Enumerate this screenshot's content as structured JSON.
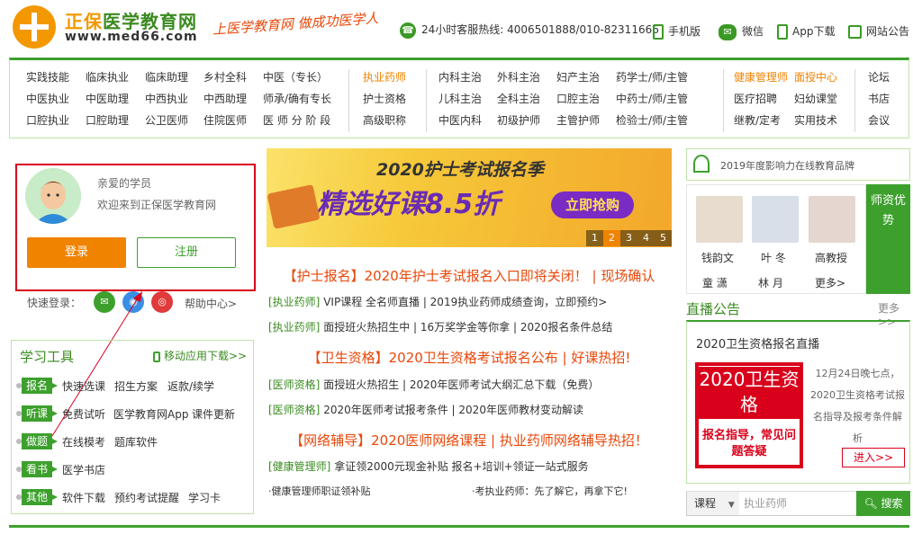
{
  "header": {
    "brand_orange": "正保",
    "brand_green": "医学教育网",
    "domain": "www.med66.com",
    "slogan": "上医学教育网 做成功医学人",
    "hotline_label": "24小时客服热线:",
    "hotline_numbers": "4006501888/010-82311666",
    "links": [
      "手机版",
      "微信",
      "App下载",
      "网站公告"
    ]
  },
  "nav": {
    "col1": [
      [
        "实践技能",
        "临床执业",
        "临床助理",
        "乡村全科",
        "中医（专长）"
      ],
      [
        "中医执业",
        "中医助理",
        "中西执业",
        "中西助理",
        "师承/确有专长"
      ],
      [
        "口腔执业",
        "口腔助理",
        "公卫医师",
        "住院医师",
        "医 师 分 阶 段"
      ]
    ],
    "col2": [
      "执业药师",
      "护士资格",
      "高级职称"
    ],
    "col3": [
      [
        "内科主治",
        "外科主治",
        "妇产主治",
        "药学士/师/主管"
      ],
      [
        "儿科主治",
        "全科主治",
        "口腔主治",
        "中药士/师/主管"
      ],
      [
        "中医内科",
        "初级护师",
        "主管护师",
        "检验士/师/主管"
      ]
    ],
    "col4": [
      [
        "健康管理师",
        "面授中心"
      ],
      [
        "医疗招聘",
        "妇幼课堂"
      ],
      [
        "继教/定考",
        "实用技术"
      ]
    ],
    "col5": [
      "论坛",
      "书店",
      "会议"
    ]
  },
  "user": {
    "greeting1": "亲爱的学员",
    "greeting2": "欢迎来到正保医学教育网",
    "login": "登录",
    "register": "注册",
    "quick_login": "快速登录：",
    "help": "帮助中心>"
  },
  "tools": {
    "title": "学习工具",
    "mobile": "移动应用下载>>",
    "rows": [
      {
        "tag": "报名",
        "links": [
          "快速选课",
          "招生方案",
          "返款/续学"
        ]
      },
      {
        "tag": "听课",
        "links": [
          "免费试听",
          "医学教育网App",
          "课件更新"
        ]
      },
      {
        "tag": "做题",
        "links": [
          "在线模考",
          "题库软件"
        ]
      },
      {
        "tag": "看书",
        "links": [
          "医学书店"
        ]
      },
      {
        "tag": "其他",
        "links": [
          "软件下载",
          "预约考试提醒",
          "学习卡"
        ]
      }
    ]
  },
  "banner": {
    "line1": "2020护士考试报名季",
    "line2": "精选好课8.5折",
    "cta": "立即抢购",
    "pages": [
      "1",
      "2",
      "3",
      "4",
      "5"
    ]
  },
  "news": {
    "h1": "【护士报名】2020年护士考试报名入口即将关闭！ | 现场确认",
    "r1": {
      "cat": "[执业药师]",
      "text": "VIP课程 全名师直播 | 2019执业药师成绩查询，立即预约>"
    },
    "r2": {
      "cat": "[执业药师]",
      "text": "面授班火热招生中 | 16万奖学金等你拿 | 2020报名条件总结"
    },
    "h2": "【卫生资格】2020卫生资格考试报名公布 | 好课热招!",
    "r3": {
      "cat": "[医师资格]",
      "text": "面授班火热招生 | 2020年医师考试大纲汇总下载（免费）"
    },
    "r4": {
      "cat": "[医师资格]",
      "text": "2020年医师考试报考条件 | 2020年医师教材变动解读"
    },
    "h3": "【网络辅导】2020医师网络课程 | 执业药师网络辅导热招！",
    "r5": {
      "cat": "[健康管理师]",
      "text": "拿证领2000元现金补贴 报名+培训+领证一站式服务"
    },
    "b1": "·健康管理师职证领补贴",
    "b2": "·考执业药师：先了解它，再拿下它!"
  },
  "right": {
    "rank": "2019年度影响力在线教育品牌",
    "teachers_row1": [
      "钱韵文",
      "叶 冬",
      "高教授"
    ],
    "teachers_row2": [
      "童 潇",
      "林 月",
      "更多>"
    ],
    "teacher_tab": "师资优势",
    "live_title": "直播公告",
    "live_more": "更多>>",
    "live_head": "2020卫生资格报名直播",
    "poster_title": "2020卫生资格",
    "poster_sub": "报名指导，常见问题答疑",
    "live_desc": "12月24日晚七点，2020卫生资格考试报名指导及报考条件解析",
    "enter": "进入>>",
    "search_select": "课程",
    "search_placeholder": "执业药师",
    "search_btn": "搜索"
  }
}
